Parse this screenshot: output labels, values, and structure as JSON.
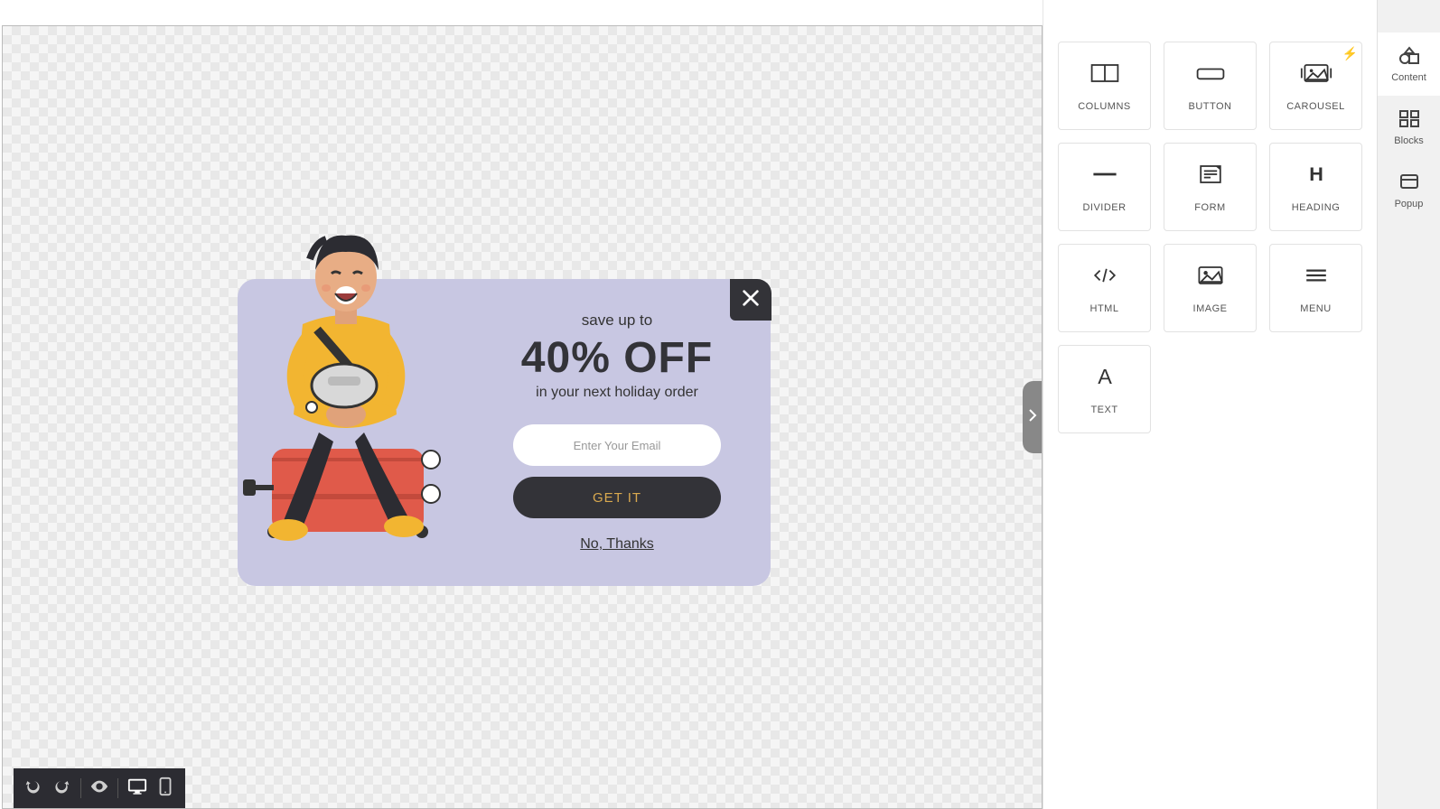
{
  "popup": {
    "preheading": "save up to",
    "heading": "40% OFF",
    "subheading": "in your next holiday order",
    "email_placeholder": "Enter Your Email",
    "cta_label": "GET IT",
    "decline_label": "No, Thanks"
  },
  "blocks": [
    {
      "label": "COLUMNS",
      "icon": "columns-icon"
    },
    {
      "label": "BUTTON",
      "icon": "button-icon"
    },
    {
      "label": "CAROUSEL",
      "icon": "carousel-icon",
      "bolt": true
    },
    {
      "label": "DIVIDER",
      "icon": "divider-icon"
    },
    {
      "label": "FORM",
      "icon": "form-icon"
    },
    {
      "label": "HEADING",
      "icon": "heading-icon"
    },
    {
      "label": "HTML",
      "icon": "html-icon"
    },
    {
      "label": "IMAGE",
      "icon": "image-icon"
    },
    {
      "label": "MENU",
      "icon": "menu-icon"
    },
    {
      "label": "TEXT",
      "icon": "text-icon"
    }
  ],
  "right_tabs": [
    {
      "label": "Content",
      "active": true
    },
    {
      "label": "Blocks",
      "active": false
    },
    {
      "label": "Popup",
      "active": false
    }
  ],
  "bottom_toolbar": {
    "undo": "undo-icon",
    "redo": "redo-icon",
    "preview": "eye-icon",
    "desktop": "desktop-icon",
    "mobile": "mobile-icon"
  }
}
